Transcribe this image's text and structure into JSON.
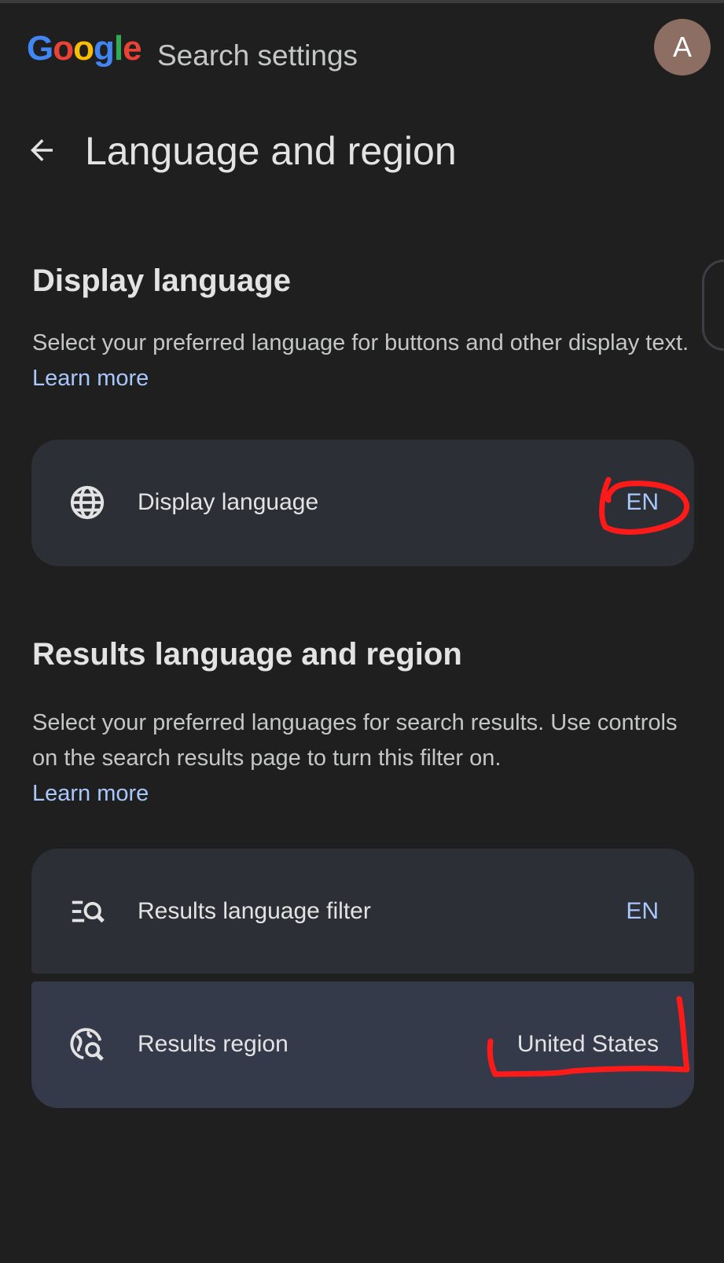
{
  "header": {
    "logo_letters": [
      {
        "char": "G",
        "color": "#4285f4"
      },
      {
        "char": "o",
        "color": "#ea4335"
      },
      {
        "char": "o",
        "color": "#fbbc05"
      },
      {
        "char": "g",
        "color": "#4285f4"
      },
      {
        "char": "l",
        "color": "#34a853"
      },
      {
        "char": "e",
        "color": "#ea4335"
      }
    ],
    "title": "Search settings",
    "avatar_initial": "A",
    "avatar_color": "#8d6e63"
  },
  "page": {
    "back_icon": "arrow-left-icon",
    "title": "Language and region"
  },
  "display_section": {
    "heading": "Display language",
    "description": "Select your preferred language for buttons and other display text.",
    "learn_more": "Learn more",
    "row": {
      "icon": "globe-icon",
      "label": "Display language",
      "value": "EN"
    }
  },
  "results_section": {
    "heading": "Results language and region",
    "description": "Select your preferred languages for search results. Use controls on the search results page to turn this filter on.",
    "learn_more": "Learn more",
    "rows": [
      {
        "icon": "filter-search-icon",
        "label": "Results language filter",
        "value": "EN"
      },
      {
        "icon": "globe-search-icon",
        "label": "Results region",
        "value": "United States"
      }
    ]
  },
  "colors": {
    "background": "#1f1f1f",
    "card": "#2d2f36",
    "link": "#a8c7fa",
    "annotation": "#ff1a1a"
  }
}
